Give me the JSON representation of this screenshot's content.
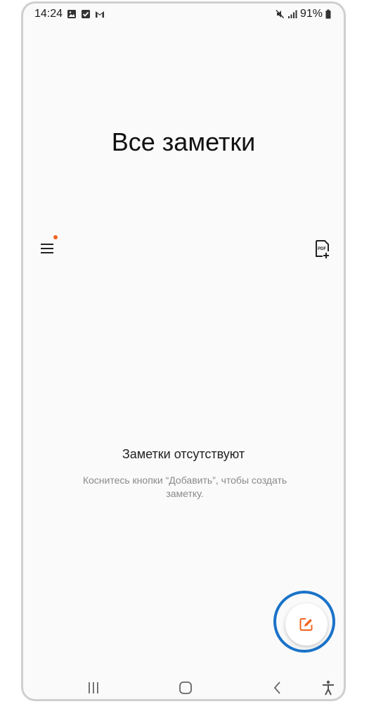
{
  "status_bar": {
    "time": "14:24",
    "battery": "91%",
    "left_icons": [
      "image-icon",
      "check-box-icon",
      "gmail-icon"
    ],
    "right_icons": [
      "mute-icon",
      "signal-icon",
      "battery-icon"
    ]
  },
  "header": {
    "title": "Все заметки"
  },
  "toolbar": {
    "menu_icon": "hamburger-menu-icon",
    "pdf_icon": "pdf-add-icon"
  },
  "empty_state": {
    "title": "Заметки отсутствуют",
    "hint": "Коснитесь кнопки “Добавить”, чтобы создать заметку."
  },
  "fab": {
    "icon": "edit-note-icon"
  },
  "nav_bar": {
    "items": [
      "recent-apps-icon",
      "home-icon",
      "back-icon",
      "accessibility-icon"
    ]
  },
  "colors": {
    "accent": "#f26522",
    "highlight_ring": "#1a73c9",
    "background": "#fafafa"
  }
}
